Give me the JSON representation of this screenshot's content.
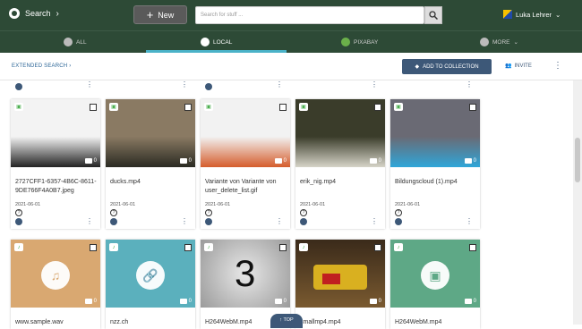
{
  "header": {
    "brand": "Search",
    "new_label": "New",
    "search_placeholder": "Search for stuff ...",
    "user_name": "Luka Lehrer"
  },
  "tabs": [
    {
      "label": "ALL"
    },
    {
      "label": "LOCAL"
    },
    {
      "label": "PIXABAY"
    },
    {
      "label": "MORE"
    }
  ],
  "toolbar": {
    "extended_search": "EXTENDED SEARCH",
    "add_to_collection": "ADD TO COLLECTION",
    "invite": "INVITE"
  },
  "cards_row1": [
    {
      "title": "2727CFF1-6357-4B6C-8611-9DE766F4A0B7.jpeg",
      "date": "2021-06-01",
      "count": "0",
      "colors": [
        "#f3f3f3",
        "#222"
      ]
    },
    {
      "title": "ducks.mp4",
      "date": "2021-06-01",
      "count": "0",
      "colors": [
        "#8a7a63",
        "#2a2a22"
      ]
    },
    {
      "title": "Variante von Variante von user_delete_list.gif",
      "date": "2021-06-01",
      "count": "0",
      "colors": [
        "#f2f2f2",
        "#d55d2c"
      ]
    },
    {
      "title": "erik_nig.mp4",
      "date": "2021-06-01",
      "count": "0",
      "colors": [
        "#3a3c2a",
        "#d6d4c8"
      ]
    },
    {
      "title": "Bildungscloud (1).mp4",
      "date": "2021-06-01",
      "count": "0",
      "colors": [
        "#6a6a74",
        "#2fa6d9"
      ]
    }
  ],
  "cards_row2": [
    {
      "title": "www.sample.wav",
      "count": "0",
      "color": "#d9a871",
      "icon": "music-note-icon",
      "glyph": "♫"
    },
    {
      "title": "nzz.ch",
      "count": "0",
      "color": "#5bb0bd",
      "icon": "link-icon",
      "glyph": "🔗"
    },
    {
      "title": "H264WebM.mp4",
      "count": "0",
      "color": "#cfcfcf",
      "icon": "countdown-image",
      "glyph": "3"
    },
    {
      "title": "smallmp4.mp4",
      "count": "0",
      "color": "#5a4230",
      "icon": "lego-image",
      "glyph": ""
    },
    {
      "title": "H264WebM.mp4",
      "count": "0",
      "color": "#5ea886",
      "icon": "film-icon",
      "glyph": "▣"
    }
  ],
  "top_button": "TOP"
}
